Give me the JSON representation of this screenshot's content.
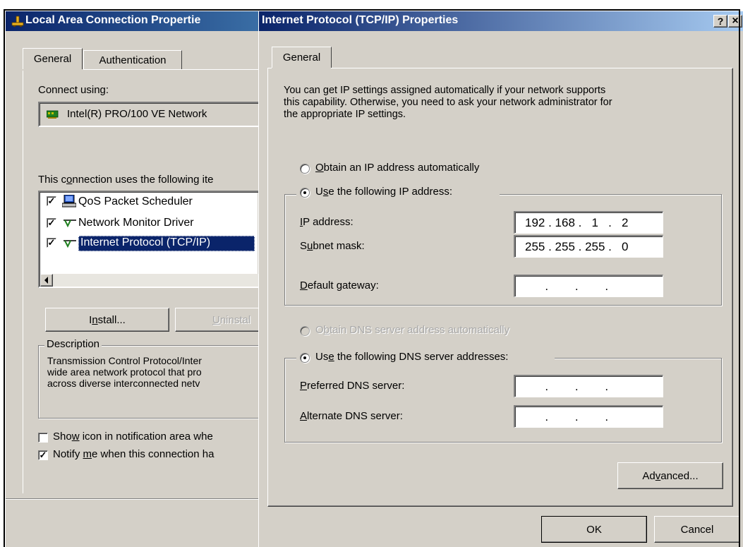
{
  "back_dialog": {
    "title": "Local Area Connection Propertie",
    "tabs": [
      "General",
      "Authentication"
    ],
    "connect_using_label": "Connect using:",
    "adapter_name": "Intel(R) PRO/100 VE Network",
    "items_label": "This connection uses the following ite",
    "items_label_accel": "o",
    "items": [
      {
        "label": "QoS Packet Scheduler",
        "checked": true,
        "icon": "qos-scheduler-icon"
      },
      {
        "label": "Network Monitor Driver",
        "checked": true,
        "icon": "network-protocol-icon"
      },
      {
        "label": "Internet Protocol (TCP/IP)",
        "checked": true,
        "icon": "network-protocol-icon",
        "selected": true
      }
    ],
    "install_label": "Install...",
    "uninstall_label": "Uninstal",
    "description_legend": "Description",
    "description_lines": [
      "Transmission Control Protocol/Inter",
      "wide area network protocol that pro",
      "across diverse interconnected netv"
    ],
    "show_icon_label": "Show icon in notification area whe",
    "show_icon_checked": false,
    "notify_label": "Notify me when this connection ha",
    "notify_checked": true
  },
  "front_dialog": {
    "title": "Internet Protocol (TCP/IP) Properties",
    "help_btn": "?",
    "close_btn": "×",
    "tab": "General",
    "intro_lines": [
      "You can get IP settings assigned automatically if your network supports",
      "this capability. Otherwise, you need to ask your network administrator for",
      "the appropriate IP settings."
    ],
    "obtain_ip_label": "Obtain an IP address automatically",
    "use_ip_label": "Use the following IP address:",
    "ip_address_label": "IP address:",
    "ip_address_value": "192 . 168 .   1   .   2",
    "subnet_label": "Subnet mask:",
    "subnet_value": "255 . 255 . 255 .   0",
    "gateway_label": "Default gateway:",
    "gateway_value": "      .        .        .",
    "obtain_dns_label": "Obtain DNS server address automatically",
    "use_dns_label": "Use the following DNS server addresses:",
    "preferred_dns_label": "Preferred DNS server:",
    "preferred_dns_value": "      .        .        .",
    "alternate_dns_label": "Alternate DNS server:",
    "alternate_dns_value": "      .        .        .",
    "advanced_label": "Advanced...",
    "ok_label": "OK",
    "cancel_label": "Cancel"
  },
  "colors": {
    "face": "#d4d0c8",
    "titlebar_start": "#0a246a",
    "titlebar_end": "#a6caf0",
    "selection": "#0a246a"
  }
}
